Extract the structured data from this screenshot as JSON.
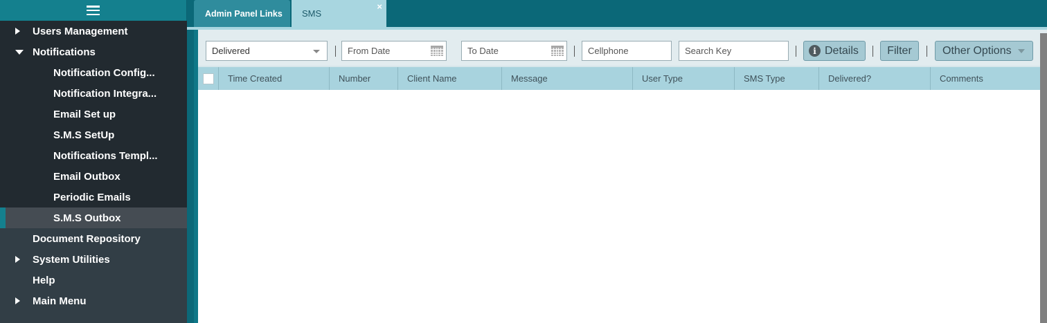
{
  "sidebar": {
    "menu_icon": "hamburger-icon",
    "items": [
      {
        "label": "Users Management",
        "caret": "right",
        "level": 1
      },
      {
        "label": "Notifications",
        "caret": "down",
        "level": 1
      },
      {
        "label": "Notification Config...",
        "level": 2
      },
      {
        "label": "Notification Integra...",
        "level": 2
      },
      {
        "label": "Email Set up",
        "level": 2
      },
      {
        "label": "S.M.S SetUp",
        "level": 2
      },
      {
        "label": "Notifications Templ...",
        "level": 2
      },
      {
        "label": "Email Outbox",
        "level": 2
      },
      {
        "label": "Periodic Emails",
        "level": 2
      },
      {
        "label": "S.M.S Outbox",
        "level": 2,
        "active": true
      },
      {
        "label": "Document Repository",
        "level": 1
      },
      {
        "label": "System Utilities",
        "caret": "right",
        "level": 1
      },
      {
        "label": "Help",
        "level": 1
      },
      {
        "label": "Main Menu",
        "caret": "right",
        "level": 1
      }
    ]
  },
  "tabs": {
    "admin": "Admin Panel Links",
    "sms": "SMS",
    "close": "×"
  },
  "toolbar": {
    "status_select": "Delivered",
    "from_date_placeholder": "From Date",
    "to_date_placeholder": "To Date",
    "cellphone_placeholder": "Cellphone",
    "search_placeholder": "Search Key",
    "details_label": "Details",
    "filter_label": "Filter",
    "other_options_label": "Other Options"
  },
  "grid": {
    "columns": [
      "Time Created",
      "Number",
      "Client Name",
      "Message",
      "User Type",
      "SMS Type",
      "Delivered?",
      "Comments"
    ],
    "rows": []
  },
  "colors": {
    "accent": "#14808e",
    "tab_active": "#a8d6e0",
    "header": "#a8d3de"
  }
}
